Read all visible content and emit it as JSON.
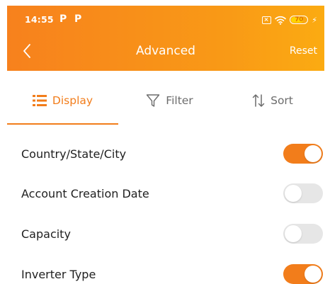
{
  "status_bar": {
    "time": "14:55",
    "app_icons": [
      "P",
      "P"
    ],
    "battery_level": "70"
  },
  "header": {
    "title": "Advanced",
    "reset_label": "Reset",
    "back_icon": "chevron-left-icon"
  },
  "tabs": [
    {
      "label": "Display",
      "icon": "list-icon",
      "active": true
    },
    {
      "label": "Filter",
      "icon": "funnel-icon",
      "active": false
    },
    {
      "label": "Sort",
      "icon": "sort-arrows-icon",
      "active": false
    }
  ],
  "display_options": [
    {
      "label": "Country/State/City",
      "enabled": true
    },
    {
      "label": "Account Creation Date",
      "enabled": false
    },
    {
      "label": "Capacity",
      "enabled": false
    },
    {
      "label": "Inverter Type",
      "enabled": true
    }
  ],
  "colors": {
    "accent": "#f27d1b",
    "header_gradient_start": "#f7811d",
    "header_gradient_end": "#fbab12",
    "toggle_off": "#e6e6e6",
    "battery_fill": "#ffd400"
  }
}
